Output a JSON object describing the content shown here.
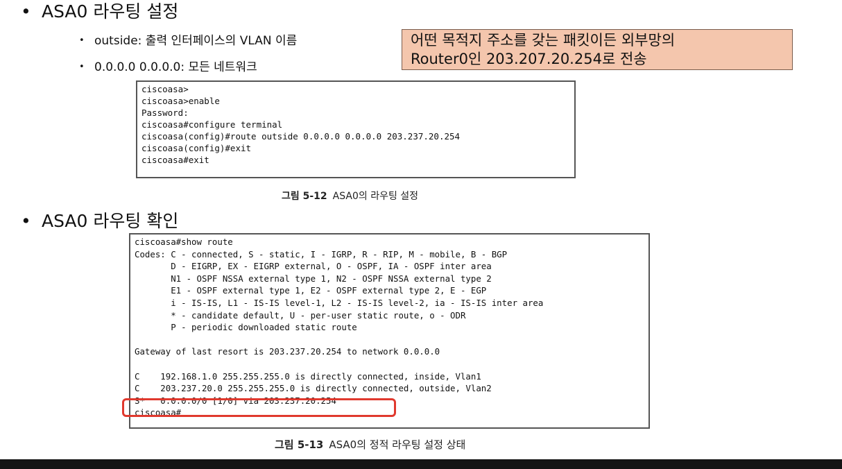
{
  "section1": {
    "bullet_glyph": "•",
    "title": "ASA0 라우팅 설정",
    "sub_bullet_glyph": "•",
    "items": [
      "outside: 출력 인터페이스의  VLAN 이름",
      "0.0.0.0 0.0.0.0: 모든 네트워크"
    ],
    "note_lines": [
      "어떤 목적지 주소를 갖는 패킷이든 외부망의",
      "Router0인 203.207.20.254로 전송"
    ],
    "terminal_lines": [
      "ciscoasa>",
      "ciscoasa>enable",
      "Password:",
      "ciscoasa#configure terminal",
      "ciscoasa(config)#route outside 0.0.0.0 0.0.0.0 203.237.20.254",
      "ciscoasa(config)#exit",
      "ciscoasa#exit"
    ],
    "caption_label": "그림 5-12",
    "caption_text": "ASA0의 라우팅 설정"
  },
  "section2": {
    "bullet_glyph": "•",
    "title": "ASA0 라우팅 확인",
    "terminal_lines": [
      "ciscoasa#show route",
      "Codes: C - connected, S - static, I - IGRP, R - RIP, M - mobile, B - BGP",
      "       D - EIGRP, EX - EIGRP external, O - OSPF, IA - OSPF inter area",
      "       N1 - OSPF NSSA external type 1, N2 - OSPF NSSA external type 2",
      "       E1 - OSPF external type 1, E2 - OSPF external type 2, E - EGP",
      "       i - IS-IS, L1 - IS-IS level-1, L2 - IS-IS level-2, ia - IS-IS inter area",
      "       * - candidate default, U - per-user static route, o - ODR",
      "       P - periodic downloaded static route",
      "",
      "Gateway of last resort is 203.237.20.254 to network 0.0.0.0",
      "",
      "C    192.168.1.0 255.255.255.0 is directly connected, inside, Vlan1",
      "C    203.237.20.0 255.255.255.0 is directly connected, outside, Vlan2",
      "S*   0.0.0.0/0 [1/0] via 203.237.20.254",
      "ciscoasa#"
    ],
    "caption_label": "그림 5-13",
    "caption_text": "ASA0의 정적 라우팅 설정 상태"
  }
}
